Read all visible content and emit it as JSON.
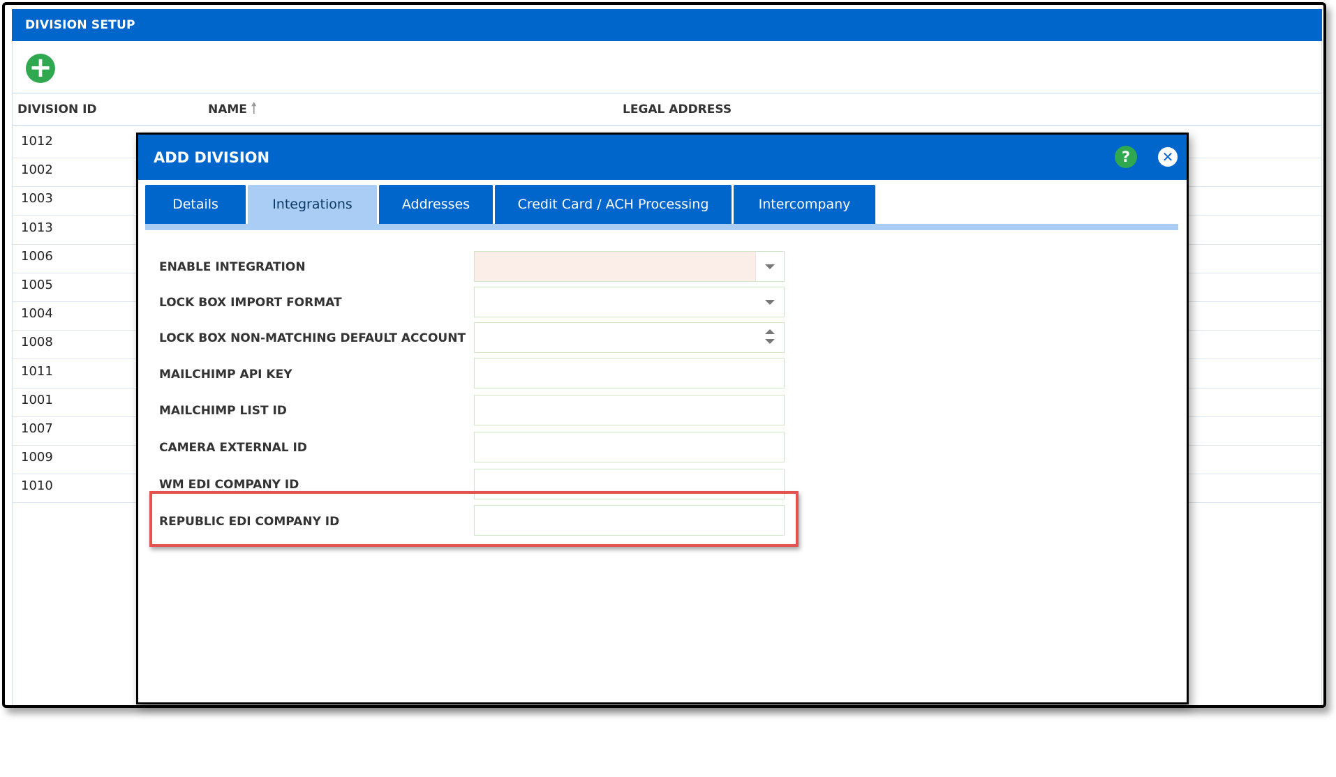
{
  "outer": {
    "title": "DIVISION SETUP",
    "add_icon": "+",
    "columns": {
      "division_id": "DIVISION ID",
      "name": "NAME",
      "legal_address": "LEGAL ADDRESS"
    },
    "sort_icon": "🠕",
    "rows": [
      "1012",
      "1002",
      "1003",
      "1013",
      "1006",
      "1005",
      "1004",
      "1008",
      "1011",
      "1001",
      "1007",
      "1009",
      "1010"
    ]
  },
  "dialog": {
    "title": "ADD DIVISION",
    "help_icon": "?",
    "close_icon": "✕",
    "tabs": [
      {
        "label": "Details"
      },
      {
        "label": "Integrations"
      },
      {
        "label": "Addresses"
      },
      {
        "label": "Credit Card / ACH Processing"
      },
      {
        "label": "Intercompany"
      }
    ],
    "active_tab": "Integrations",
    "fields": [
      {
        "label": "ENABLE INTEGRATION",
        "type": "dropdown",
        "value": ""
      },
      {
        "label": "LOCK BOX IMPORT FORMAT",
        "type": "dropdown",
        "value": ""
      },
      {
        "label": "LOCK BOX NON-MATCHING DEFAULT ACCOUNT",
        "type": "spinner",
        "value": ""
      },
      {
        "label": "MAILCHIMP API KEY",
        "type": "text",
        "value": ""
      },
      {
        "label": "MAILCHIMP LIST ID",
        "type": "text",
        "value": ""
      },
      {
        "label": "CAMERA EXTERNAL ID",
        "type": "text",
        "value": ""
      },
      {
        "label": "WM EDI COMPANY ID",
        "type": "text",
        "value": ""
      },
      {
        "label": "REPUBLIC EDI COMPANY ID",
        "type": "text",
        "value": ""
      }
    ]
  },
  "colors": {
    "header_blue": "#0066cc",
    "active_tab": "#a9cdf4",
    "add_green": "#2fa84f",
    "highlight_red": "#e4524f"
  }
}
